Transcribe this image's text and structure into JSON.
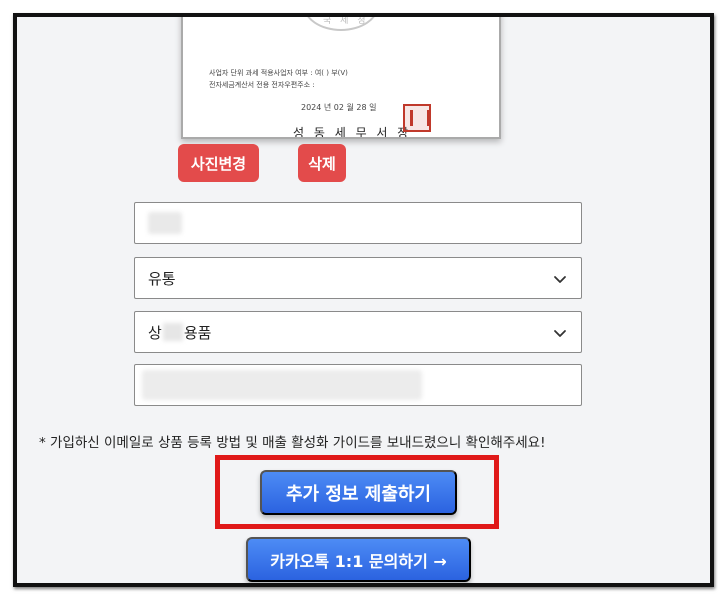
{
  "document_image": {
    "seal_text": "국 세 청",
    "line1": "사업자 단위 과세 적용사업자 여부 : 여( ) 부(V)",
    "line2": "전자세금계산서 전용 전자우편주소 :",
    "date": "2024 년 02 월 28 일",
    "office": "성 동 세 무 서 장"
  },
  "buttons": {
    "change_photo": "사진변경",
    "delete": "삭제",
    "submit": "추가 정보 제출하기",
    "kakao": "카카오톡 1:1 문의하기 →"
  },
  "fields": {
    "business_type": "유통",
    "category_prefix": "상",
    "category_suffix": "용품"
  },
  "notice": "* 가입하신 이메일로 상품 등록 방법 및 매출 활성화 가이드를 보내드렸으니 확인해주세요!",
  "colors": {
    "red_button": "#e34b4b",
    "blue_button": "#2b63e0",
    "highlight": "#e01919",
    "background": "#f3f4f6"
  }
}
